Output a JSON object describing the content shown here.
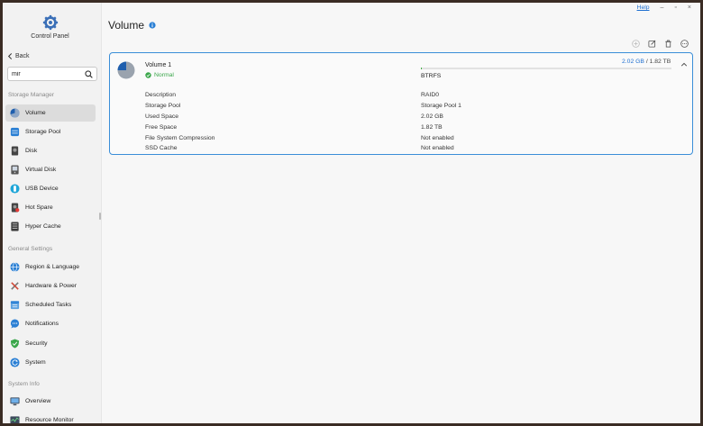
{
  "app": {
    "title": "Control Panel",
    "back_label": "Back",
    "search": {
      "value": "mir",
      "placeholder": ""
    }
  },
  "titlebar": {
    "help": "Help",
    "minimize": "–",
    "maximize": "▫",
    "close": "×"
  },
  "sidebar": {
    "sections": [
      {
        "title": "Storage Manager"
      },
      {
        "title": "General Settings"
      },
      {
        "title": "System Info"
      }
    ],
    "items": [
      {
        "label": "Volume",
        "icon": "volume-pie-icon",
        "active": true
      },
      {
        "label": "Storage Pool",
        "icon": "storage-pool-icon"
      },
      {
        "label": "Disk",
        "icon": "disk-icon"
      },
      {
        "label": "Virtual Disk",
        "icon": "virtual-disk-icon"
      },
      {
        "label": "USB Device",
        "icon": "usb-icon"
      },
      {
        "label": "Hot Spare",
        "icon": "hot-spare-icon"
      },
      {
        "label": "Hyper Cache",
        "icon": "hyper-cache-icon"
      },
      {
        "label": "Region & Language",
        "icon": "globe-icon"
      },
      {
        "label": "Hardware & Power",
        "icon": "tools-icon"
      },
      {
        "label": "Scheduled Tasks",
        "icon": "calendar-icon"
      },
      {
        "label": "Notifications",
        "icon": "chat-bubble-icon"
      },
      {
        "label": "Security",
        "icon": "shield-icon"
      },
      {
        "label": "System",
        "icon": "refresh-icon"
      },
      {
        "label": "Overview",
        "icon": "monitor-icon"
      },
      {
        "label": "Resource Monitor",
        "icon": "resource-monitor-icon"
      }
    ]
  },
  "main": {
    "title": "Volume",
    "toolbar": [
      "add-icon",
      "edit-icon",
      "delete-icon",
      "more-icon"
    ],
    "volume": {
      "name": "Volume 1",
      "status": "Normal",
      "used": "2.02 GB",
      "separator": " / ",
      "total": "1.82 TB",
      "usage_fraction": 0.002,
      "filesystem": "BTRFS",
      "properties": [
        {
          "label": "Description",
          "value": "RAID0"
        },
        {
          "label": "Storage Pool",
          "value": "Storage Pool 1"
        },
        {
          "label": "Used Space",
          "value": "2.02 GB"
        },
        {
          "label": "Free Space",
          "value": "1.82 TB"
        },
        {
          "label": "File System Compression",
          "value": "Not enabled"
        },
        {
          "label": "SSD Cache",
          "value": "Not enabled"
        }
      ]
    }
  },
  "colors": {
    "accent": "#1e6fd0",
    "card_border": "#3a8ed8",
    "status_ok": "#3aa64a",
    "active_item_bg": "#dcdcdc"
  }
}
